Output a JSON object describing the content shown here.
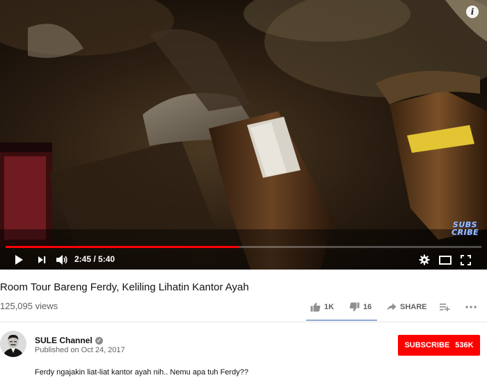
{
  "player": {
    "info_icon": "info-icon",
    "watermark_line1": "SUBS",
    "watermark_line2": "CRIBE",
    "progress_fraction": 0.49,
    "time_display": "2:45 / 5:40",
    "controls": [
      "play-icon",
      "next-icon",
      "volume-icon",
      "settings-icon",
      "theater-icon",
      "fullscreen-icon"
    ],
    "colors": {
      "progress_played": "#ff0000"
    }
  },
  "video": {
    "title": "Room Tour Bareng Ferdy, Keliling Lihatin Kantor Ayah",
    "views": "125,095 views",
    "likes": "1K",
    "dislikes": "16",
    "share_label": "SHARE",
    "add_icon": "add-to-playlist-icon",
    "more_icon": "more-icon"
  },
  "channel": {
    "name": "SULE Channel",
    "published": "Published on Oct 24, 2017",
    "subscribe_label": "SUBSCRIBE",
    "subscriber_count": "536K",
    "colors": {
      "subscribe_button": "#ff0000"
    }
  },
  "description": "Ferdy ngajakin liat-liat kantor ayah nih.. Nemu apa tuh Ferdy??"
}
